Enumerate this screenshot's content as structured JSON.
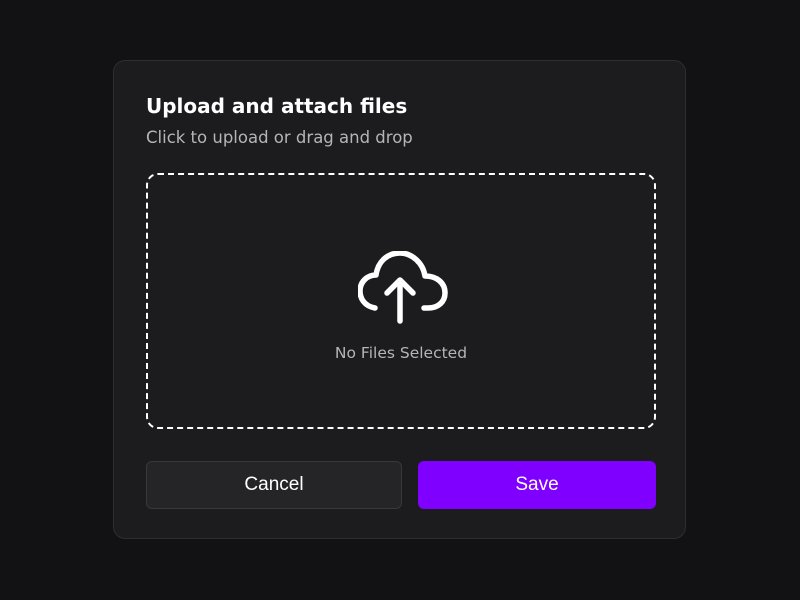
{
  "dialog": {
    "title": "Upload and attach files",
    "subtitle": "Click to upload or drag and drop",
    "dropzone": {
      "icon": "cloud-upload-icon",
      "status_text": "No Files Selected"
    },
    "actions": {
      "cancel_label": "Cancel",
      "save_label": "Save"
    }
  },
  "colors": {
    "page_background": "#121214",
    "dialog_background": "#1c1c1e",
    "accent": "#8000ff",
    "secondary_button": "#252527",
    "muted_text": "#b4b4b9"
  }
}
